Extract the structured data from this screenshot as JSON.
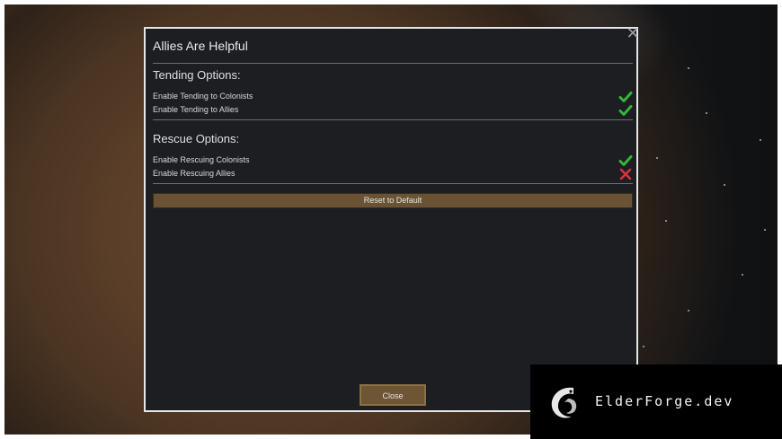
{
  "dialog": {
    "title": "Allies Are Helpful",
    "close_icon": "close-x-icon",
    "sections": [
      {
        "title": "Tending Options:",
        "options": [
          {
            "label": "Enable Tending to Colonists",
            "enabled": true
          },
          {
            "label": "Enable Tending to Allies",
            "enabled": true
          }
        ]
      },
      {
        "title": "Rescue Options:",
        "options": [
          {
            "label": "Enable Rescuing Colonists",
            "enabled": true
          },
          {
            "label": "Enable Rescuing Allies",
            "enabled": false
          }
        ]
      }
    ],
    "reset_label": "Reset to Default",
    "close_label": "Close"
  },
  "watermark": {
    "text": "ElderForge.dev",
    "logo_icon": "dragon-logo-icon"
  },
  "colors": {
    "check": "#36b53a",
    "cross": "#d8343a",
    "button": "#6a5334",
    "panel": "#1c1e22"
  }
}
